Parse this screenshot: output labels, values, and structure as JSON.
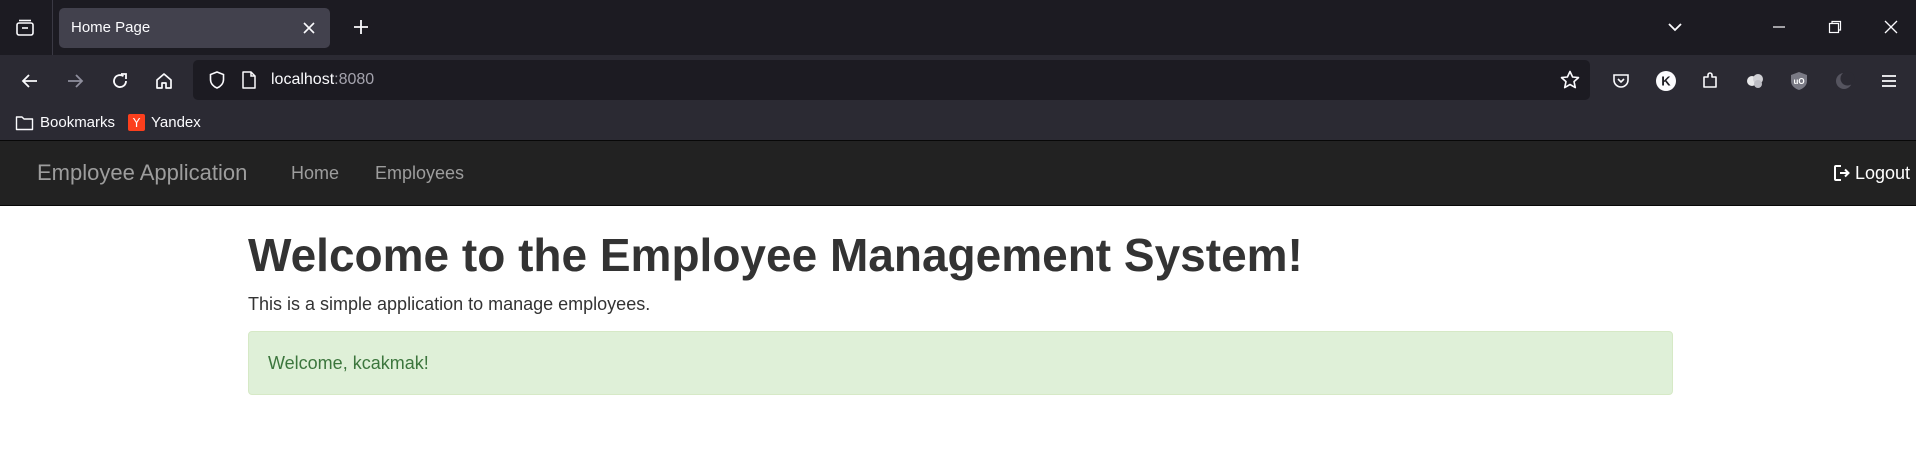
{
  "browser": {
    "tab": {
      "title": "Home Page"
    },
    "url": {
      "host": "localhost",
      "port": ":8080"
    },
    "bookmarks": [
      {
        "label": "Bookmarks",
        "icon": "folder-icon"
      },
      {
        "label": "Yandex",
        "icon": "yandex-icon",
        "badge": "Y"
      }
    ],
    "extensions": [
      {
        "icon": "pocket-icon"
      },
      {
        "icon": "profile-k-icon",
        "letter": "K"
      },
      {
        "icon": "extensions-puzzle-icon"
      },
      {
        "icon": "cloud-extension-icon"
      },
      {
        "icon": "ublock-origin-icon"
      },
      {
        "icon": "dark-reader-icon"
      },
      {
        "icon": "menu-hamburger-icon"
      }
    ]
  },
  "app": {
    "brand": "Employee Application",
    "nav": [
      {
        "label": "Home"
      },
      {
        "label": "Employees"
      }
    ],
    "logout_label": "Logout"
  },
  "page": {
    "title": "Welcome to the Employee Management System!",
    "lead": "This is a simple application to manage employees.",
    "alert": "Welcome, kcakmak!"
  },
  "colors": {
    "browser_chrome": "#1c1b22",
    "toolbar": "#2b2a33",
    "navbar": "#222222",
    "alert_bg": "#dff0d8",
    "alert_text": "#3c763d"
  }
}
